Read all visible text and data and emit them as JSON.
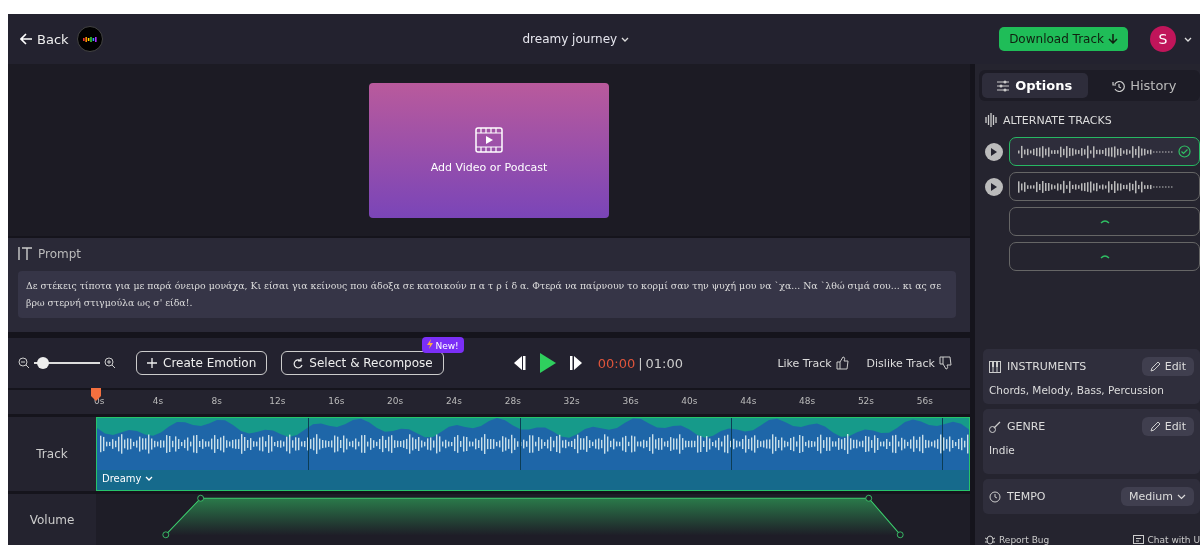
{
  "header": {
    "back_label": "Back",
    "project_title": "dreamy journey",
    "download_label": "Download Track",
    "avatar_initial": "S"
  },
  "video": {
    "label": "Add Video or Podcast"
  },
  "prompt": {
    "label": "Prompt",
    "text": "Δε στέκεις τίποτα για με παρά όνειρο μονάχα, Κι είσαι για κείνους που άδοξα σε κατοικούν π α τ ρ ί δ α. Φτερά να παίρνουν το κορμί σαν την ψυχή μου να `χα... Να `λθώ σιμά σου... κι ας σε βρω στερνή στιγμούλα ως σ' είδα!."
  },
  "controls": {
    "zoom": {
      "level": 0.05
    },
    "create_emotion": "Create Emotion",
    "select_recompose": "Select & Recompose",
    "new_badge": "New!",
    "time_current": "00:00",
    "time_separator": "|",
    "time_total": "01:00",
    "like": "Like Track",
    "dislike": "Dislike Track"
  },
  "timeline": {
    "ticks": [
      "0s",
      "4s",
      "8s",
      "12s",
      "16s",
      "20s",
      "24s",
      "28s",
      "32s",
      "36s",
      "40s",
      "44s",
      "48s",
      "52s",
      "56s"
    ],
    "track_label": "Track",
    "segment_label": "Dreamy",
    "volume_label": "Volume"
  },
  "panel": {
    "tabs": [
      {
        "label": "Options",
        "selected": true
      },
      {
        "label": "History",
        "selected": false
      }
    ],
    "alternate_title": "ALTERNATE TRACKS",
    "alternates": [
      {
        "kind": "waveform",
        "selected": true
      },
      {
        "kind": "waveform",
        "selected": false
      },
      {
        "kind": "loading",
        "selected": false
      },
      {
        "kind": "loading",
        "selected": false
      }
    ],
    "instruments": {
      "title": "INSTRUMENTS",
      "edit": "Edit",
      "value": "Chords, Melody, Bass, Percussion"
    },
    "genre": {
      "title": "GENRE",
      "edit": "Edit",
      "value": "Indie"
    },
    "tempo": {
      "title": "TEMPO",
      "value": "Medium"
    },
    "footer": {
      "report": "Report Bug",
      "chat": "Chat with U"
    }
  }
}
